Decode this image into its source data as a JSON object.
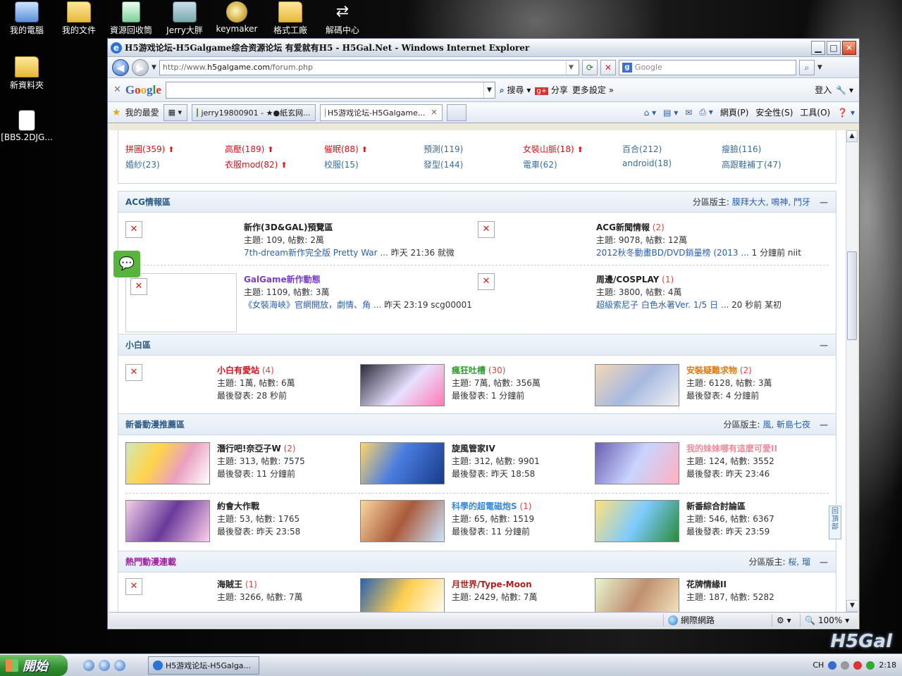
{
  "desktop": {
    "icons": [
      {
        "label": "我的電腦",
        "icon": "computer-icon"
      },
      {
        "label": "我的文件",
        "icon": "folder-icon"
      },
      {
        "label": "資源回收筒",
        "icon": "recycle-bin-icon"
      },
      {
        "label": "Jerry大胖",
        "icon": "app-icon"
      },
      {
        "label": "keymaker",
        "icon": "key-icon"
      },
      {
        "label": "格式工廠",
        "icon": "folder-icon"
      },
      {
        "label": "解碼中心",
        "icon": "arrows-icon"
      },
      {
        "label": "新資料夾",
        "icon": "folder-icon"
      },
      {
        "label": "[BBS.2DJG...",
        "icon": "document-icon"
      }
    ]
  },
  "window": {
    "title": "H5游戏论坛-H5Galgame综合资源论坛 有爱就有H5 - H5Gal.Net - Windows Internet Explorer",
    "address": {
      "prefix": "http://www.",
      "host": "h5galgame.com",
      "path": "/forum.php"
    },
    "search_placeholder": "Google",
    "google_bar": {
      "search_label": "搜尋",
      "share_label": "分享",
      "more_settings": "更多設定 »",
      "login": "登入"
    },
    "favorites_label": "我的最愛",
    "tabs": [
      {
        "label": "jerry19800901 - ★●紙玄网...",
        "active": false
      },
      {
        "label": "H5游戏论坛-H5Galgame...",
        "active": true
      }
    ],
    "commands": {
      "page": "網頁(P)",
      "safety": "安全性(S)",
      "tools": "工具(O)"
    },
    "status": {
      "zone": "網際網路",
      "zoom": "100%"
    }
  },
  "forum": {
    "tags_row1": [
      {
        "label": "拼圖(359)",
        "hot": true,
        "color": "red"
      },
      {
        "label": "高壓(189)",
        "hot": true,
        "color": "red"
      },
      {
        "label": "催眠(88)",
        "hot": true,
        "color": "red"
      },
      {
        "label": "預測(119)",
        "hot": false,
        "color": "blue"
      },
      {
        "label": "女裝山脈(18)",
        "hot": true,
        "color": "red"
      },
      {
        "label": "百合(212)",
        "hot": false,
        "color": "blue"
      },
      {
        "label": "瘦臉(116)",
        "hot": false,
        "color": "blue"
      }
    ],
    "tags_row2": [
      {
        "label": "婚紗(23)",
        "hot": false,
        "color": "blue"
      },
      {
        "label": "衣服mod(82)",
        "hot": true,
        "color": "red"
      },
      {
        "label": "校服(15)",
        "hot": false,
        "color": "blue"
      },
      {
        "label": "發型(144)",
        "hot": false,
        "color": "blue"
      },
      {
        "label": "電車(62)",
        "hot": false,
        "color": "blue"
      },
      {
        "label": "android(18)",
        "hot": false,
        "color": "blue"
      },
      {
        "label": "高跟鞋補丁(47)",
        "hot": false,
        "color": "blue"
      }
    ],
    "acg": {
      "title": "ACG情報區",
      "mods_label": "分區版主:",
      "mods": "膜拜大大, 鳴神, 鬥牙",
      "boards": [
        {
          "name": "新作(3D&GAL)預覽區",
          "count": "",
          "stats": "主題: 109, 帖數: 2萬",
          "last": "7th-dream新作完全版 Pretty War ...",
          "when": "昨天 21:36 就微"
        },
        {
          "name": "ACG新聞情報",
          "count": "(2)",
          "stats": "主題: 9078, 帖數: 12萬",
          "last": "2012秋冬動畫BD/DVD銷量榜 (2013 ...",
          "when": "1 分鐘前 niit"
        },
        {
          "name": "GalGame新作動態",
          "count": "",
          "stats": "主題: 1109, 帖數: 3萬",
          "last": "《女裝海峽》官網開放，劇情、角 ...",
          "when": "昨天 23:19 scg00001"
        },
        {
          "name": "周邊/COSPLAY",
          "count": "(1)",
          "stats": "主題: 3800, 帖數: 4萬",
          "last": "超級索尼子 白色水著Ver. 1/5 日 ...",
          "when": "20 秒前 某初"
        }
      ]
    },
    "xiaobai": {
      "title": "小白區",
      "boards": [
        {
          "name": "小白有愛站",
          "count": "(4)",
          "stats": "主題: 1萬, 帖數: 6萬",
          "last": "最後發表: 28 秒前",
          "color": "red"
        },
        {
          "name": "瘋狂吐槽",
          "count": "(30)",
          "stats": "主題: 7萬, 帖數: 356萬",
          "last": "最後發表: 1 分鐘前",
          "color": "green"
        },
        {
          "name": "安裝疑難求物",
          "count": "(2)",
          "stats": "主題: 6128, 帖數: 3萬",
          "last": "最後發表: 4 分鐘前",
          "color": "orange"
        }
      ]
    },
    "xinfan": {
      "title": "新番動漫推薦區",
      "mods_label": "分區版主:",
      "mods": "風, 斬島七夜",
      "boards": [
        {
          "name": "潛行吧!奈亞子W",
          "count": "(2)",
          "stats": "主題: 313, 帖數: 7575",
          "last": "最後發表: 11 分鐘前",
          "color": "dark"
        },
        {
          "name": "旋風管家IV",
          "count": "",
          "stats": "主題: 312, 帖數: 9901",
          "last": "最後發表: 昨天 18:58",
          "color": "dark"
        },
        {
          "name": "我的妹妹哪有這麼可愛II",
          "count": "",
          "stats": "主題: 124, 帖數: 3552",
          "last": "最後發表: 昨天 23:46",
          "color": "pink"
        },
        {
          "name": "約會大作戰",
          "count": "",
          "stats": "主題: 53, 帖數: 1765",
          "last": "最後發表: 昨天 23:58",
          "color": "dark"
        },
        {
          "name": "科學的超電磁炮S",
          "count": "(1)",
          "stats": "主題: 65, 帖數: 1519",
          "last": "最後發表: 11 分鐘前",
          "color": "blue"
        },
        {
          "name": "新番綜合討論區",
          "count": "",
          "stats": "主題: 546, 帖數: 6367",
          "last": "最後發表: 昨天 23:59",
          "color": "dark"
        }
      ]
    },
    "hot": {
      "title": "熱門動漫連載",
      "mods_label": "分區版主:",
      "mods": "桜, 瑠",
      "boards": [
        {
          "name": "海賊王",
          "count": "(1)",
          "stats": "主題: 3266, 帖數: 7萬",
          "color": "dark"
        },
        {
          "name": "月世界/Type-Moon",
          "count": "",
          "stats": "主題: 2429, 帖數: 7萬",
          "color": "maroon"
        },
        {
          "name": "花牌情緣II",
          "count": "",
          "stats": "主題: 187, 帖數: 5282",
          "color": "dark"
        }
      ]
    },
    "back_to_top": "回頂部"
  },
  "taskbar": {
    "start": "開始",
    "task": "H5游戏论坛-H5Galga...",
    "tray_lang": "CH",
    "clock": "2:18"
  },
  "watermark": "H5Gal"
}
